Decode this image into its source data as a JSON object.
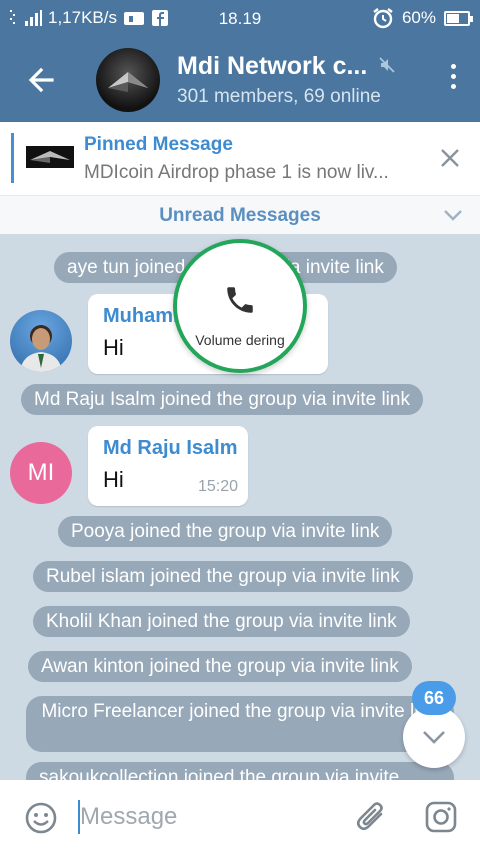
{
  "status": {
    "net_speed": "1,17KB/s",
    "time": "18.19",
    "battery": "60%",
    "battery_level": 0.6
  },
  "header": {
    "title": "Mdi Network c...",
    "subtitle": "301 members, 69 online"
  },
  "pinned": {
    "title": "Pinned Message",
    "text": "MDIcoin Airdrop phase 1 is now liv..."
  },
  "unread_label": "Unread Messages",
  "services": [
    "aye tun joined the group via invite link",
    "Md Raju Isalm joined the group via invite link",
    "Pooya joined the group via invite link",
    "Rubel islam joined the group via invite link",
    "Kholil Khan joined the group via invite link",
    "Awan kinton joined the group via invite link",
    "Micro Freelancer joined the group via invite link",
    "sakoukcollection joined the group via invite"
  ],
  "messages": [
    {
      "sender": "Muhammad",
      "text": "Hi",
      "time": ""
    },
    {
      "sender": "Md Raju Isalm",
      "text": "Hi",
      "time": "15:20",
      "avatar_initials": "MI"
    }
  ],
  "call_overlay": {
    "label": "Volume dering"
  },
  "unread_count": "66",
  "composer": {
    "placeholder": "Message"
  },
  "colors": {
    "header": "#4a76a0",
    "accent": "#3d8bd0",
    "call_ring": "#23a55a",
    "avatar_mi": "#e9699a",
    "badge": "#4a9ce8"
  }
}
